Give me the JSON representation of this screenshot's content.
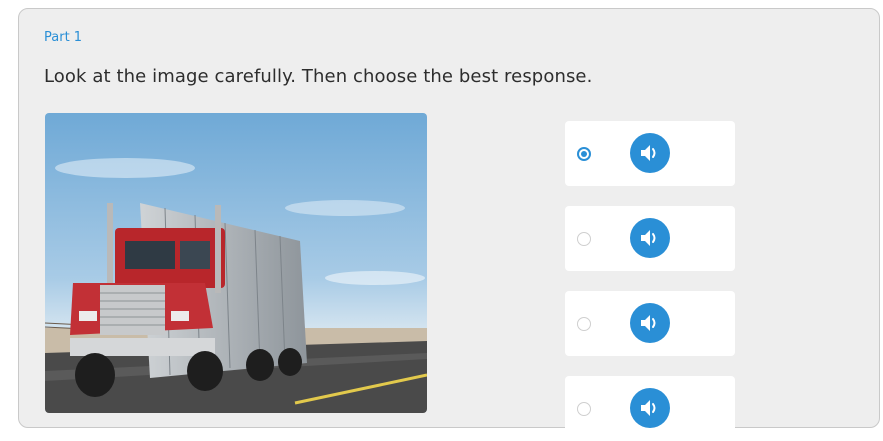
{
  "question": {
    "part_label": "Part 1",
    "prompt": "Look at the image carefully. Then choose the best response."
  },
  "image": {
    "subject": "red semi-truck with grey trailer on a desert highway"
  },
  "options": [
    {
      "selected": true,
      "icon": "speaker-icon"
    },
    {
      "selected": false,
      "icon": "speaker-icon"
    },
    {
      "selected": false,
      "icon": "speaker-icon"
    },
    {
      "selected": false,
      "icon": "speaker-icon"
    }
  ],
  "colors": {
    "accent": "#2a8fd6",
    "card_background": "#eeeeee",
    "option_background": "#ffffff",
    "text": "#2d2d2d"
  }
}
